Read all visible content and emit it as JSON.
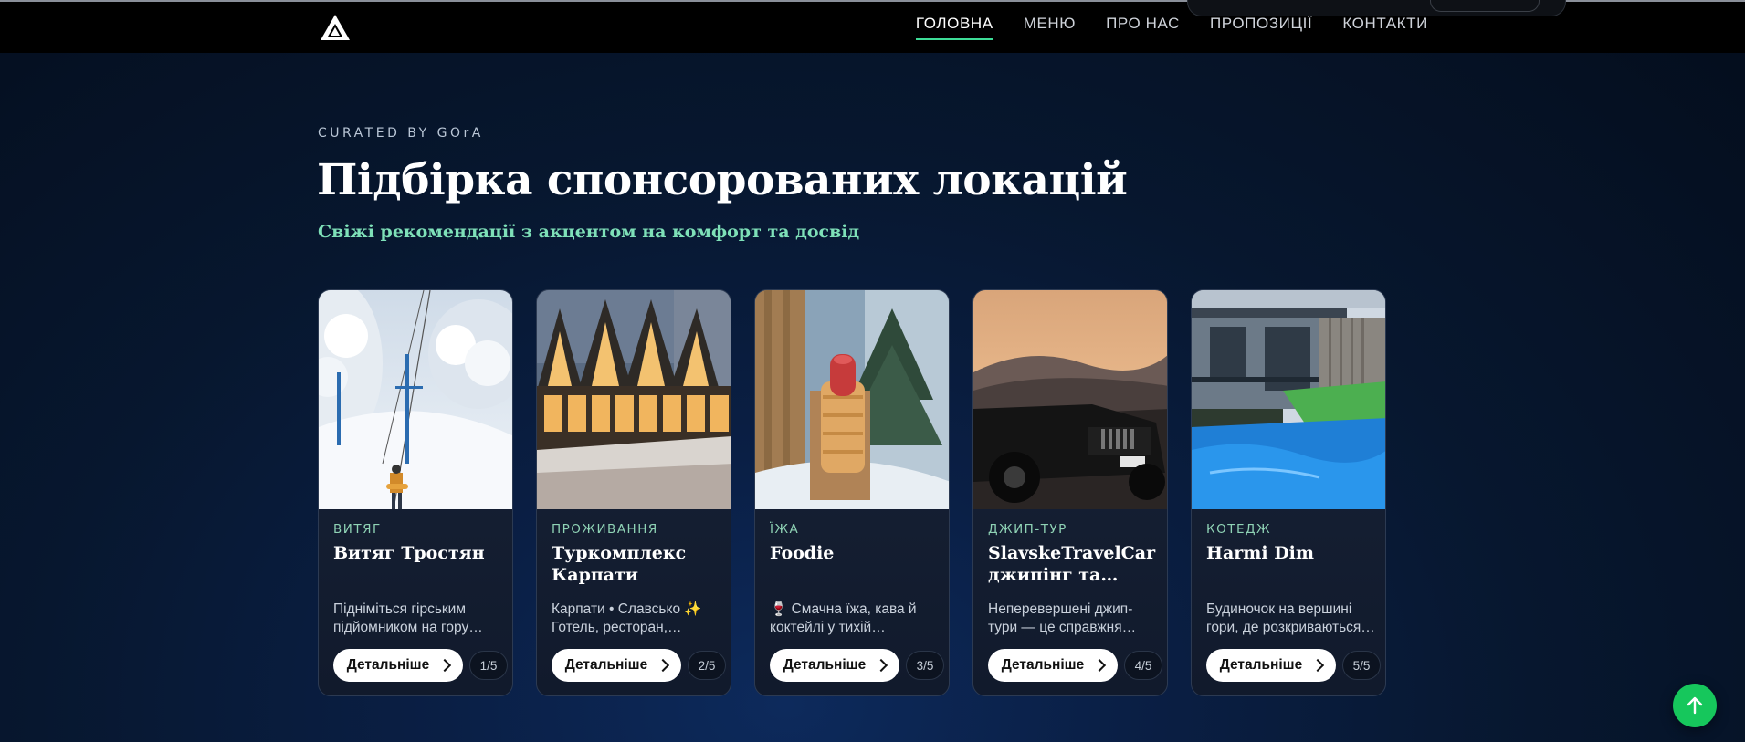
{
  "nav": {
    "items": [
      {
        "label": "ГОЛОВНА",
        "active": true
      },
      {
        "label": "МЕНЮ",
        "active": false
      },
      {
        "label": "ПРО НАС",
        "active": false
      },
      {
        "label": "ПРОПОЗИЦІЇ",
        "active": false
      },
      {
        "label": "КОНТАКТИ",
        "active": false
      }
    ]
  },
  "hero": {
    "eyebrow": "CURATED BY GOrA",
    "title": "Підбірка спонсорованих локацій",
    "subtitle": "Свіжі рекомендації з акцентом на комфорт та досвід"
  },
  "cards": [
    {
      "category": "ВИТЯГ",
      "title": "Витяг Тростян",
      "desc_line1": "Підніміться гірським",
      "desc_line2": "підйомником на гору…",
      "button": "Детальніше",
      "counter": "1/5",
      "image": "ski-lift-snow"
    },
    {
      "category": "ПРОЖИВАННЯ",
      "title_line1": "Туркомплекс",
      "title_line2": "Карпати",
      "desc_line1": "Карпати • Славсько ✨",
      "desc_line2": "Готель, ресторан,…",
      "button": "Детальніше",
      "counter": "2/5",
      "image": "a-frame-hotel"
    },
    {
      "category": "ЇЖА",
      "title": "Foodie",
      "desc_line1": "🍷 Смачна їжа, кава й",
      "desc_line2": "коктейлі у тихій…",
      "button": "Детальніше",
      "counter": "3/5",
      "image": "hot-dog-snow"
    },
    {
      "category": "ДЖИП-ТУР",
      "title_line1": "SlavskeTravelCar",
      "title_line2": "джипінг та…",
      "desc_line1": "Неперевершені джип-",
      "desc_line2": "тури — це справжня…",
      "button": "Детальніше",
      "counter": "4/5",
      "image": "jeep-mountains"
    },
    {
      "category": "КОТЕДЖ",
      "title": "Harmi Dim",
      "desc_line1": "Будиночок на вершині",
      "desc_line2": "гори, де розкриваються…",
      "button": "Детальніше",
      "counter": "5/5",
      "image": "cottage-pool"
    }
  ],
  "colors": {
    "accent": "#3ddc97",
    "category": "#8fd3b5",
    "scroll_button": "#16c75c"
  }
}
